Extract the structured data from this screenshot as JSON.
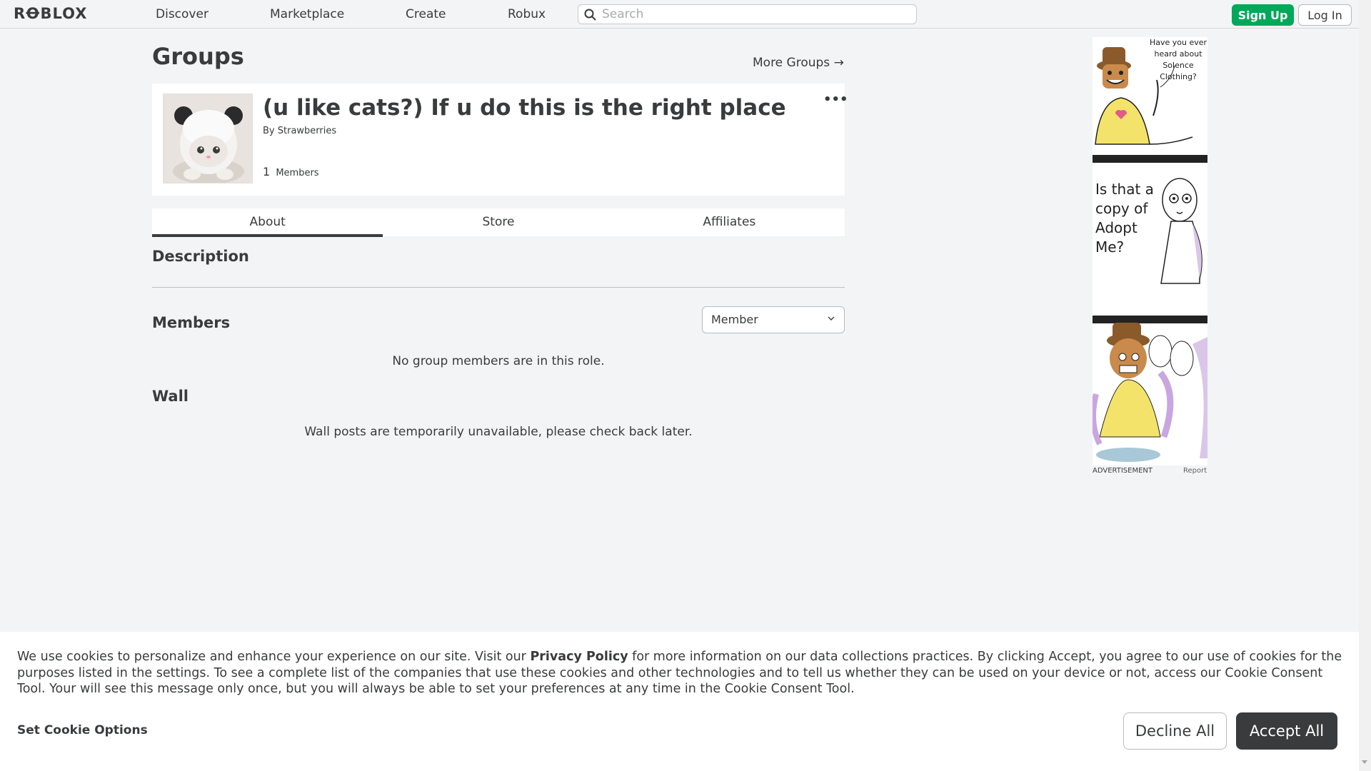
{
  "nav": {
    "logo": "RꝊBLOX",
    "links": [
      "Discover",
      "Marketplace",
      "Create",
      "Robux"
    ],
    "search_placeholder": "Search",
    "signup_label": "Sign Up",
    "login_label": "Log In"
  },
  "page": {
    "title": "Groups",
    "more_groups": "More Groups →"
  },
  "group": {
    "name": "(u like cats?) If u do this is the right place",
    "by_label": "By",
    "owner": "Strawberries",
    "member_count": "1",
    "members_label": "Members",
    "menu_glyph": "•••"
  },
  "tabs": [
    "About",
    "Store",
    "Affiliates"
  ],
  "about": {
    "description_heading": "Description",
    "members_heading": "Members",
    "role_selected": "Member",
    "no_members": "No group members are in this role.",
    "wall_heading": "Wall",
    "wall_unavailable": "Wall posts are temporarily unavailable, please check back later."
  },
  "ad": {
    "panel1_text": "Have you ever heard about Solence Clothing?",
    "panel2_text": "Is that a copy of Adopt Me?",
    "label": "ADVERTISEMENT",
    "report": "Report"
  },
  "cookie": {
    "text_before": "We use cookies to personalize and enhance your experience on our site. Visit our ",
    "privacy_link": "Privacy Policy",
    "text_after": " for more information on our data collections practices. By clicking Accept, you agree to our use of cookies for the purposes listed in the settings. To see a complete list of the companies that use these cookies and other technologies and to tell us whether they can be used on your device or not, access our Cookie Consent Tool. Your will see this message only once, but you will always be able to set your preferences at any time in the Cookie Consent Tool.",
    "options_label": "Set Cookie Options",
    "decline_label": "Decline All",
    "accept_label": "Accept All"
  }
}
